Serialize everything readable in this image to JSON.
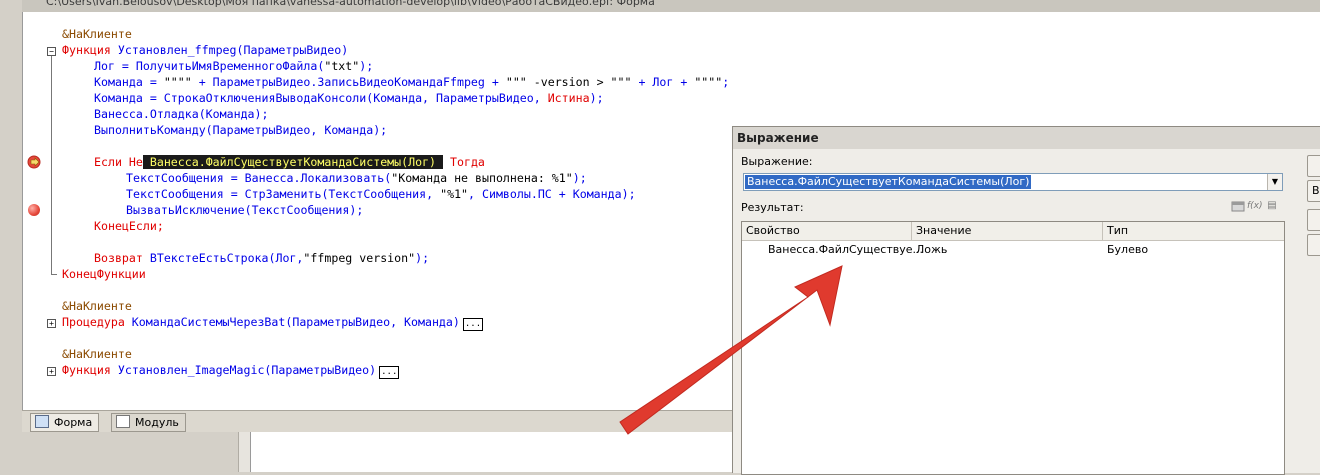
{
  "window": {
    "title": "C:\\Users\\Ivan.Belousov\\Desktop\\Моя папка\\vanessa-automation-develop\\lib\\Video\\РаботаСВидео.epf: Форма"
  },
  "code": {
    "line1": "&НаКлиенте",
    "line2_kw": "Функция",
    "line2_rest": " Установлен_ffmpeg(ПараметрыВидео)",
    "line3_a": "Лог = ПолучитьИмяВременногоФайла(",
    "line3_str": "\"txt\"",
    "line3_b": ");",
    "line4_a": "Команда = ",
    "line4_s1": "\"\"\"\"",
    "line4_b": " + ПараметрыВидео.ЗаписьВидеоКомандаFfmpeg + ",
    "line4_s2": "\"\"\" -version > \"\"\"",
    "line4_c": " + Лог + ",
    "line4_s3": "\"\"\"\"",
    "line4_d": ";",
    "line5_a": "Команда = СтрокаОтключенияВыводаКонсоли(Команда, ПараметрыВидео, ",
    "line5_kw": "Истина",
    "line5_b": ");",
    "line6": "Ванесса.Отладка(Команда);",
    "line7": "ВыполнитьКоманду(ПараметрыВидео, Команда);",
    "line8_kw1": "Если Не",
    "line8_sel": " Ванесса.ФайлСуществуетКомандаСистемы(Лог) ",
    "line8_kw2": "Тогда",
    "line9_a": "ТекстСообщения = Ванесса.Локализовать(",
    "line9_str": "\"Команда не выполнена: %1\"",
    "line9_b": ");",
    "line10_a": "ТекстСообщения = СтрЗаменить(ТекстСообщения, ",
    "line10_str": "\"%1\"",
    "line10_b": ", Символы.ПС + Команда);",
    "line11": "ВызватьИсключение(ТекстСообщения);",
    "line12": "КонецЕсли;",
    "line13_kw": "Возврат",
    "line13_a": " ВТекстеЕстьСтрока(Лог,",
    "line13_str": "\"ffmpeg version\"",
    "line13_b": ");",
    "line14": "КонецФункции",
    "line15": "&НаКлиенте",
    "line16_kw": "Процедура",
    "line16_rest": " КомандаСистемыЧерезBat(ПараметрыВидео, Команда)",
    "line17": "&НаКлиенте",
    "line18_kw": "Функция",
    "line18_rest": " Установлен_ImageMagic(ПараметрыВидео)",
    "collapsed": "...",
    "fold_minus": "−",
    "fold_plus": "+"
  },
  "tabs": [
    {
      "label": "Форма"
    },
    {
      "label": "Модуль"
    }
  ],
  "dialog": {
    "title": "Выражение",
    "expression_label": "Выражение:",
    "expression_value": "Ванесса.ФайлСуществуетКомандаСистемы(Лог)",
    "combo_arrow": "▼",
    "result_label": "Результат:",
    "columns": [
      "Свойство",
      "Значение",
      "Тип"
    ],
    "rows": [
      {
        "property": "Ванесса.ФайлСуществуе...",
        "value": "Ложь",
        "type": "Булево"
      }
    ],
    "side_buttons": [
      "",
      "Вы",
      "",
      ""
    ],
    "tool_icons": [
      "table-icon",
      "function-icon",
      "print-icon"
    ],
    "tool_glyphs": {
      "function": "f(x)",
      "print": "▤"
    }
  },
  "colors": {
    "keyword": "#e00000",
    "identifier": "#0000e8",
    "preprocessor": "#8b4a00",
    "selection_bg": "#1a1a1a",
    "selection_fg": "#ffff66",
    "annotation_arrow": "#e03a2e"
  }
}
